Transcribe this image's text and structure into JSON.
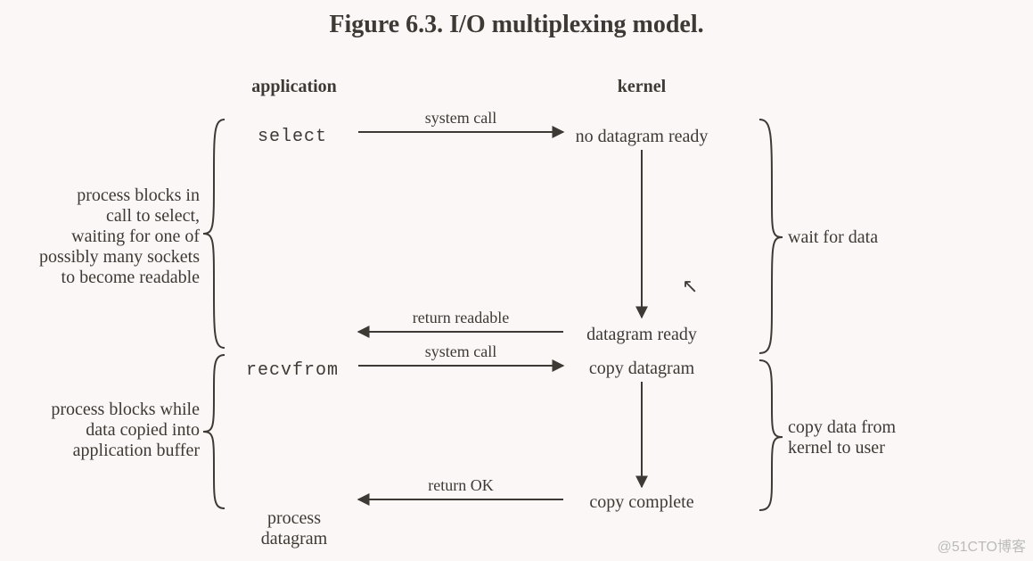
{
  "title": "Figure 6.3. I/O multiplexing model.",
  "columns": {
    "application": "application",
    "kernel": "kernel"
  },
  "app_calls": {
    "select": "select",
    "recvfrom": "recvfrom"
  },
  "left_braces": {
    "upper": "process blocks in\ncall to select,\nwaiting for one of\npossibly many sockets\nto become readable",
    "lower": "process blocks while\ndata copied into\napplication buffer"
  },
  "right_braces": {
    "upper": "wait for data",
    "lower": "copy data from\nkernel to user"
  },
  "arrows": {
    "a_select_syscall": "system call",
    "a_return_readable": "return readable",
    "a_recvfrom_syscall": "system call",
    "a_return_ok": "return OK"
  },
  "kernel_states": {
    "no_dgram": "no datagram ready",
    "dgram_ready": "datagram ready",
    "copy_dgram": "copy datagram",
    "copy_complete": "copy complete"
  },
  "footer": "process\ndatagram",
  "watermark": "@51CTO博客"
}
